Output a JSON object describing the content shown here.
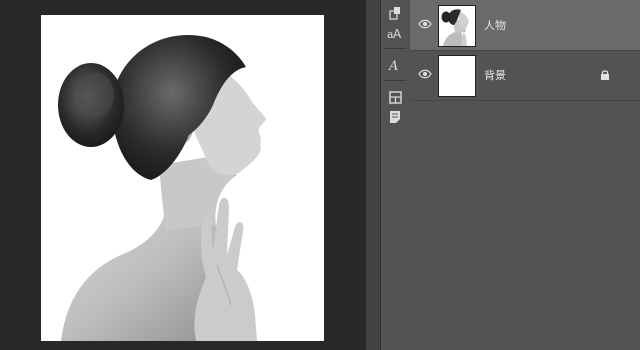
{
  "canvas": {
    "image": "woman-profile-photo"
  },
  "toolstrip": {
    "tools": [
      "layer-style-icon",
      "character-icon",
      "paragraph-style-icon",
      "properties-icon",
      "notes-icon"
    ]
  },
  "layers": {
    "items": [
      {
        "name": "人物",
        "visible": true,
        "locked": false,
        "selected": true,
        "thumbnail": "woman-portrait"
      },
      {
        "name": "背景",
        "visible": true,
        "locked": true,
        "selected": false,
        "thumbnail": "white-fill"
      }
    ]
  },
  "colors": {
    "canvas_bg": "#282828",
    "panel_bg": "#535353",
    "selected_row": "#6a6a6a",
    "text": "#e6e6e6"
  }
}
